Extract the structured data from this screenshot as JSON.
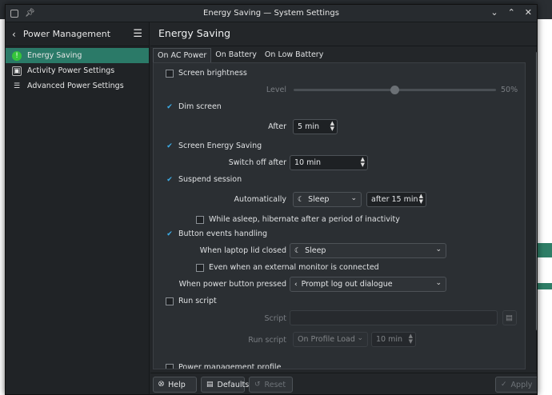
{
  "window": {
    "title": "Energy Saving — System Settings"
  },
  "icons": {
    "app": "settings-app-icon",
    "pin": "pin-icon",
    "minimize": "chevron-down-icon",
    "maximize": "chevron-up-icon",
    "close": "close-icon"
  },
  "sidebar": {
    "title": "Power Management",
    "items": [
      {
        "label": "Energy Saving",
        "icon": "power-icon",
        "active": true
      },
      {
        "label": "Activity Power Settings",
        "icon": "battery-icon",
        "active": false
      },
      {
        "label": "Advanced Power Settings",
        "icon": "list-icon",
        "active": false
      }
    ]
  },
  "main": {
    "title": "Energy Saving",
    "tabs": [
      "On AC Power",
      "On Battery",
      "On Low Battery"
    ],
    "active_tab": 0
  },
  "settings": {
    "screen_brightness": {
      "label": "Screen brightness",
      "checked": false,
      "level_label": "Level",
      "level_value": "50%",
      "level_fraction": 0.5
    },
    "dim_screen": {
      "label": "Dim screen",
      "checked": true,
      "after_label": "After",
      "after_value": "5 min"
    },
    "screen_energy_saving": {
      "label": "Screen Energy Saving",
      "checked": true,
      "switch_off_label": "Switch off after",
      "switch_off_value": "10 min"
    },
    "suspend_session": {
      "label": "Suspend session",
      "checked": true,
      "automatically_label": "Automatically",
      "action_value": "Sleep",
      "after_value": "after 15 min",
      "hibernate_label": "While asleep, hibernate after a period of inactivity",
      "hibernate_checked": false
    },
    "button_events": {
      "label": "Button events handling",
      "checked": true,
      "lid_label": "When laptop lid closed",
      "lid_value": "Sleep",
      "external_monitor_label": "Even when an external monitor is connected",
      "external_monitor_checked": false,
      "power_button_label": "When power button pressed",
      "power_button_value": "Prompt log out dialogue"
    },
    "run_script": {
      "label": "Run script",
      "checked": false,
      "script_label": "Script",
      "script_value": "",
      "run_script_label": "Run script",
      "run_when_value": "On Profile Load",
      "run_after_value": "10 min"
    },
    "power_profile": {
      "label": "Power management profile",
      "checked": false
    }
  },
  "footer": {
    "help": "Help",
    "defaults": "Defaults",
    "reset": "Reset",
    "apply": "Apply"
  },
  "colors": {
    "accent": "#2b7a68",
    "check": "#3daee9"
  }
}
